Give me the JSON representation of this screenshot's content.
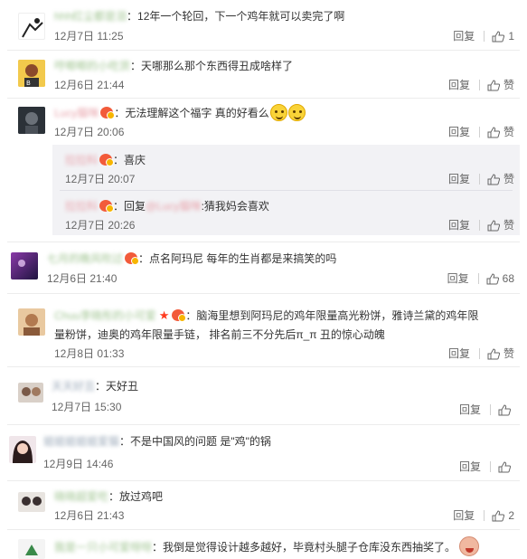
{
  "comments": [
    {
      "user": "hhh红尘都是泪",
      "text": "：12年一个轮回，下一个鸡年就可以卖完了啊",
      "time": "12月7日 11:25",
      "reply": "回复",
      "likes": "1"
    },
    {
      "user": "哼唧唧的小吃货",
      "text": "：天哪那么那个东西得丑成啥样了",
      "time": "12月6日 21:44",
      "reply": "回复",
      "likes": "赞"
    },
    {
      "user": "Lucy猫咪",
      "text": "：无法理解这个福字 真的好看么",
      "time": "12月7日 20:06",
      "reply": "回复",
      "likes": "赞",
      "replies": [
        {
          "user": "拉拉科",
          "text": "：喜庆",
          "time": "12月7日 20:07",
          "reply": "回复",
          "likes": "赞"
        },
        {
          "user": "拉拉科",
          "text_prefix": "：回复",
          "mention": "@Lucy猫咪",
          "text": ":猜我妈会喜欢",
          "time": "12月7日 20:26",
          "reply": "回复",
          "likes": "赞"
        }
      ]
    },
    {
      "user": "七月的晚风吹过",
      "text": "：点名阿玛尼 每年的生肖都是来搞笑的吗",
      "time": "12月6日 21:40",
      "reply": "回复",
      "likes": "68"
    },
    {
      "user": "Chuu李晓彤的小可爱",
      "text_line1": "：脑海里想到阿玛尼的鸡年限量高光粉饼，雅诗兰黛的鸡年限",
      "text_line2": "量粉饼，迪奥的鸡年限量手链， 排名前三不分先后π_π 丑的惊心动魄",
      "time": "12月8日 01:33",
      "reply": "回复",
      "likes": "赞"
    },
    {
      "user": "天天好丑",
      "text": "：天好丑",
      "time": "12月7日 15:30",
      "reply": "回复",
      "likes": ""
    },
    {
      "user": "姐姐姐姐姐爱猫",
      "text": "：不是中国风的问题 是\"鸡\"的锅",
      "time": "12月9日 14:46",
      "reply": "回复",
      "likes": ""
    },
    {
      "user": "晓晓超爱吃",
      "text": "：放过鸡吧",
      "time": "12月6日 21:43",
      "reply": "回复",
      "likes": "2"
    },
    {
      "user": "我是一只小可爱呀呀",
      "text": "：我倒是觉得设计越多越好，毕竟村头腿子仓库没东西抽奖了。"
    }
  ]
}
